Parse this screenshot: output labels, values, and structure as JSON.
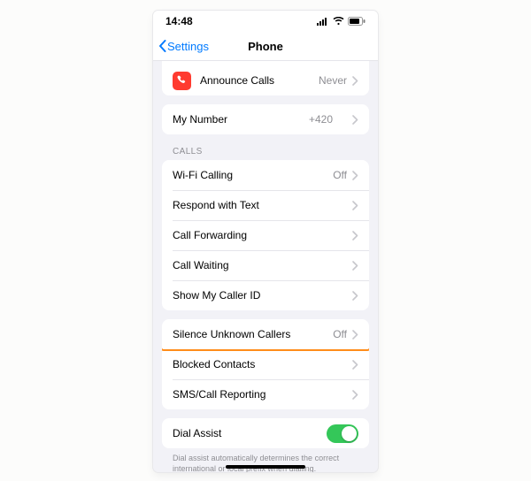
{
  "status": {
    "time": "14:48"
  },
  "nav": {
    "back": "Settings",
    "title": "Phone"
  },
  "headers": {
    "calls": "CALLS"
  },
  "groups": {
    "announce": [
      {
        "label": "Announce Calls",
        "value": "Never"
      }
    ],
    "my_number": [
      {
        "label": "My Number",
        "value": "+420"
      }
    ],
    "calls": [
      {
        "label": "Wi-Fi Calling",
        "value": "Off"
      },
      {
        "label": "Respond with Text",
        "value": ""
      },
      {
        "label": "Call Forwarding",
        "value": ""
      },
      {
        "label": "Call Waiting",
        "value": ""
      },
      {
        "label": "Show My Caller ID",
        "value": ""
      }
    ],
    "silence": [
      {
        "label": "Silence Unknown Callers",
        "value": "Off"
      },
      {
        "label": "Blocked Contacts",
        "value": ""
      },
      {
        "label": "SMS/Call Reporting",
        "value": ""
      }
    ],
    "dial_assist": [
      {
        "label": "Dial Assist",
        "toggle": true
      }
    ]
  },
  "footers": {
    "dial_assist": "Dial assist automatically determines the correct international or local prefix when dialling."
  }
}
